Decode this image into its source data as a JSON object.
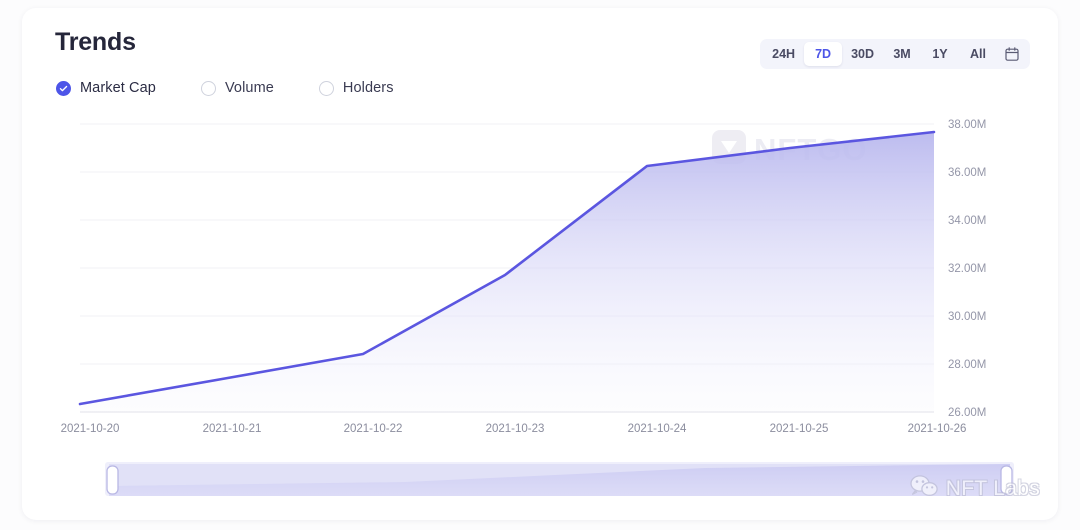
{
  "card": {
    "title": "Trends"
  },
  "metrics": [
    {
      "label": "Market Cap",
      "selected": true
    },
    {
      "label": "Volume",
      "selected": false
    },
    {
      "label": "Holders",
      "selected": false
    }
  ],
  "range_selector": {
    "options": [
      {
        "label": "24H",
        "active": false
      },
      {
        "label": "7D",
        "active": true
      },
      {
        "label": "30D",
        "active": false
      },
      {
        "label": "3M",
        "active": false
      },
      {
        "label": "1Y",
        "active": false
      },
      {
        "label": "All",
        "active": false
      }
    ],
    "calendar_icon": "calendar-icon"
  },
  "watermarks": {
    "chart": "NFTGO",
    "footer": "NFT Labs",
    "footer_icon": "wechat-icon"
  },
  "colors": {
    "accent": "#4d55e8",
    "line": "#5b56e0",
    "area_top": "#c3c2f2",
    "area_bottom": "#f6f6fd",
    "active_tab_bg": "#ffffff",
    "tab_bar_bg": "#f3f4fb",
    "grid": "#f2f2f6",
    "tick_text": "#8b8d9e"
  },
  "chart_data": {
    "type": "area",
    "title": "Trends",
    "metric": "Market Cap",
    "range": "7D",
    "xlabel": "",
    "ylabel": "",
    "grid": true,
    "legend": "none",
    "x": [
      "2021-10-20",
      "2021-10-21",
      "2021-10-22",
      "2021-10-23",
      "2021-10-24",
      "2021-10-25",
      "2021-10-26"
    ],
    "series": [
      {
        "name": "Market Cap",
        "values": [
          26.3,
          27.35,
          28.4,
          31.7,
          36.25,
          37.0,
          37.65
        ]
      }
    ],
    "ylim": [
      26.0,
      38.0
    ],
    "ytick_values": [
      26.0,
      28.0,
      30.0,
      32.0,
      34.0,
      36.0,
      38.0
    ],
    "ytick_labels": [
      "26.00M",
      "28.00M",
      "30.00M",
      "32.00M",
      "34.00M",
      "36.00M",
      "38.00M"
    ],
    "unit": "M"
  },
  "brush": {
    "start_percent": 0,
    "end_percent": 100
  }
}
